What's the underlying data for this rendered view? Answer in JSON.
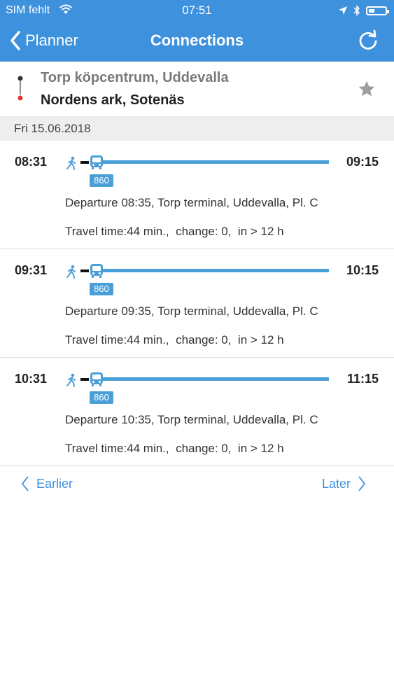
{
  "status": {
    "carrier": "SIM fehlt",
    "time": "07:51"
  },
  "nav": {
    "back_label": "Planner",
    "title": "Connections"
  },
  "route": {
    "from": "Torp köpcentrum, Uddevalla",
    "to": "Nordens ark, Sotenäs"
  },
  "date": "Fri 15.06.2018",
  "connections": [
    {
      "dep": "08:31",
      "arr": "09:15",
      "line": "860",
      "departure": "Departure 08:35, Torp terminal, Uddevalla, Pl. C",
      "travel": "Travel time:44 min.,  change: 0,  in > 12 h"
    },
    {
      "dep": "09:31",
      "arr": "10:15",
      "line": "860",
      "departure": "Departure 09:35, Torp terminal, Uddevalla, Pl. C",
      "travel": "Travel time:44 min.,  change: 0,  in > 12 h"
    },
    {
      "dep": "10:31",
      "arr": "11:15",
      "line": "860",
      "departure": "Departure 10:35, Torp terminal, Uddevalla, Pl. C",
      "travel": "Travel time:44 min.,  change: 0,  in > 12 h"
    }
  ],
  "pager": {
    "earlier": "Earlier",
    "later": "Later"
  },
  "colors": {
    "accent": "#3e91dd",
    "line": "#4b9fd8"
  }
}
